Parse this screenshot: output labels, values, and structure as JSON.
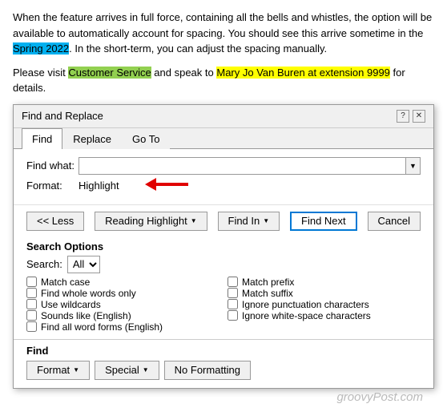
{
  "prose": {
    "line1": "When the feature arrives in full force, containing all the bells and whistles, the option will be available to automatically account for spacing. You should see this arrive sometime in the ",
    "highlight1": "Spring 2022",
    "line1_end": ". In the short-term, you can adjust the spacing manually.",
    "line2_start": "Please visit ",
    "highlight2": "Customer Service",
    "line2_mid": " and speak to ",
    "highlight3": "Mary Jo Van Buren at extension 9999",
    "line2_end": " for details."
  },
  "dialog": {
    "title": "Find and Replace",
    "help_btn": "?",
    "close_btn": "✕",
    "tabs": [
      "Find",
      "Replace",
      "Go To"
    ],
    "active_tab": "Find",
    "find_label": "Find what:",
    "find_value": "",
    "format_label": "Format:",
    "format_value": "Highlight",
    "less_btn": "<< Less",
    "reading_highlight_btn": "Reading Highlight",
    "find_in_btn": "Find In",
    "find_next_btn": "Find Next",
    "cancel_btn": "Cancel",
    "search_options_title": "Search Options",
    "search_label": "Search:",
    "search_value": "All",
    "checkboxes_left": [
      {
        "label": "Match case",
        "checked": false
      },
      {
        "label": "Find whole words only",
        "checked": false
      },
      {
        "label": "Use wildcards",
        "checked": false
      },
      {
        "label": "Sounds like (English)",
        "checked": false
      },
      {
        "label": "Find all word forms (English)",
        "checked": false
      }
    ],
    "checkboxes_right": [
      {
        "label": "Match prefix",
        "checked": false
      },
      {
        "label": "Match suffix",
        "checked": false
      },
      {
        "label": "Ignore punctuation characters",
        "checked": false
      },
      {
        "label": "Ignore white-space characters",
        "checked": false
      }
    ],
    "bottom_title": "Find",
    "format_bottom_btn": "Format",
    "special_btn": "Special",
    "no_formatting_btn": "No Formatting"
  },
  "watermark": "groovyPost.com"
}
